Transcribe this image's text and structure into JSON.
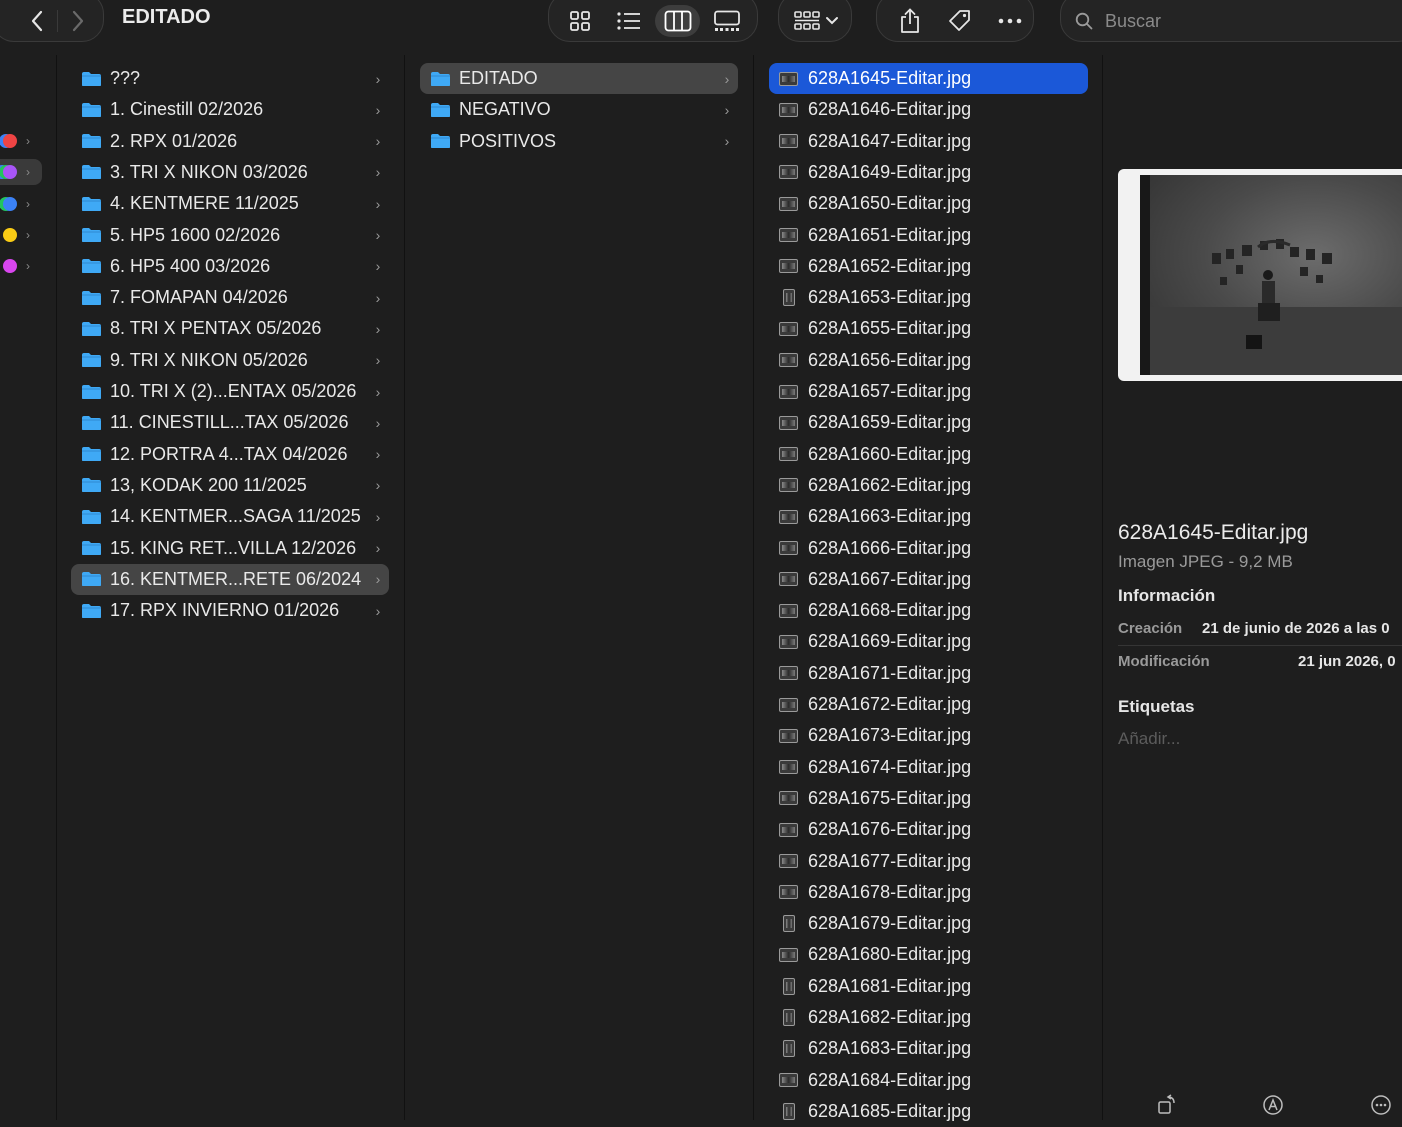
{
  "window": {
    "title": "EDITADO",
    "search_placeholder": "Buscar"
  },
  "sidebar": {
    "tags": [
      {
        "colors": [
          "#3b82f6",
          "#ef4444"
        ],
        "selected": false
      },
      {
        "colors": [
          "#3b82f6",
          "#22c55e",
          "#a855f7"
        ],
        "selected": true
      },
      {
        "colors": [
          "#22c55e",
          "#3b82f6"
        ],
        "selected": false
      },
      {
        "colors": [
          "#facc15"
        ],
        "selected": false
      },
      {
        "colors": [
          "#d946ef"
        ],
        "selected": false
      }
    ]
  },
  "column1": {
    "items": [
      {
        "label": "???",
        "selected": false
      },
      {
        "label": "1. Cinestill 02/2026",
        "selected": false
      },
      {
        "label": "2. RPX 01/2026",
        "selected": false
      },
      {
        "label": "3. TRI X NIKON  03/2026",
        "selected": false
      },
      {
        "label": "4. KENTMERE 11/2025",
        "selected": false
      },
      {
        "label": "5. HP5 1600 02/2026",
        "selected": false
      },
      {
        "label": "6. HP5 400 03/2026",
        "selected": false
      },
      {
        "label": "7. FOMAPAN 04/2026",
        "selected": false
      },
      {
        "label": "8. TRI X PENTAX 05/2026",
        "selected": false
      },
      {
        "label": "9. TRI X NIKON 05/2026",
        "selected": false
      },
      {
        "label": "10. TRI X (2)...ENTAX 05/2026",
        "selected": false
      },
      {
        "label": "11. CINESTILL...TAX 05/2026",
        "selected": false
      },
      {
        "label": "12. PORTRA 4...TAX 04/2026",
        "selected": false
      },
      {
        "label": "13, KODAK 200 11/2025",
        "selected": false
      },
      {
        "label": "14. KENTMER...SAGA 11/2025",
        "selected": false
      },
      {
        "label": "15. KING RET...VILLA 12/2026",
        "selected": false
      },
      {
        "label": "16. KENTMER...RETE 06/2024",
        "selected": true
      },
      {
        "label": "17. RPX INVIERNO 01/2026",
        "selected": false
      }
    ]
  },
  "column2": {
    "items": [
      {
        "label": "EDITADO",
        "selected": true
      },
      {
        "label": "NEGATIVO",
        "selected": false
      },
      {
        "label": "POSITIVOS",
        "selected": false
      }
    ]
  },
  "column3": {
    "files": [
      {
        "name": "628A1645-Editar.jpg",
        "selected": true,
        "orientation": "landscape"
      },
      {
        "name": "628A1646-Editar.jpg",
        "selected": false,
        "orientation": "landscape"
      },
      {
        "name": "628A1647-Editar.jpg",
        "selected": false,
        "orientation": "landscape"
      },
      {
        "name": "628A1649-Editar.jpg",
        "selected": false,
        "orientation": "landscape"
      },
      {
        "name": "628A1650-Editar.jpg",
        "selected": false,
        "orientation": "landscape"
      },
      {
        "name": "628A1651-Editar.jpg",
        "selected": false,
        "orientation": "landscape"
      },
      {
        "name": "628A1652-Editar.jpg",
        "selected": false,
        "orientation": "landscape"
      },
      {
        "name": "628A1653-Editar.jpg",
        "selected": false,
        "orientation": "portrait"
      },
      {
        "name": "628A1655-Editar.jpg",
        "selected": false,
        "orientation": "landscape"
      },
      {
        "name": "628A1656-Editar.jpg",
        "selected": false,
        "orientation": "landscape"
      },
      {
        "name": "628A1657-Editar.jpg",
        "selected": false,
        "orientation": "landscape"
      },
      {
        "name": "628A1659-Editar.jpg",
        "selected": false,
        "orientation": "landscape"
      },
      {
        "name": "628A1660-Editar.jpg",
        "selected": false,
        "orientation": "landscape"
      },
      {
        "name": "628A1662-Editar.jpg",
        "selected": false,
        "orientation": "landscape"
      },
      {
        "name": "628A1663-Editar.jpg",
        "selected": false,
        "orientation": "landscape"
      },
      {
        "name": "628A1666-Editar.jpg",
        "selected": false,
        "orientation": "landscape"
      },
      {
        "name": "628A1667-Editar.jpg",
        "selected": false,
        "orientation": "landscape"
      },
      {
        "name": "628A1668-Editar.jpg",
        "selected": false,
        "orientation": "landscape"
      },
      {
        "name": "628A1669-Editar.jpg",
        "selected": false,
        "orientation": "landscape"
      },
      {
        "name": "628A1671-Editar.jpg",
        "selected": false,
        "orientation": "landscape"
      },
      {
        "name": "628A1672-Editar.jpg",
        "selected": false,
        "orientation": "landscape"
      },
      {
        "name": "628A1673-Editar.jpg",
        "selected": false,
        "orientation": "landscape"
      },
      {
        "name": "628A1674-Editar.jpg",
        "selected": false,
        "orientation": "landscape"
      },
      {
        "name": "628A1675-Editar.jpg",
        "selected": false,
        "orientation": "landscape"
      },
      {
        "name": "628A1676-Editar.jpg",
        "selected": false,
        "orientation": "landscape"
      },
      {
        "name": "628A1677-Editar.jpg",
        "selected": false,
        "orientation": "landscape"
      },
      {
        "name": "628A1678-Editar.jpg",
        "selected": false,
        "orientation": "landscape"
      },
      {
        "name": "628A1679-Editar.jpg",
        "selected": false,
        "orientation": "portrait"
      },
      {
        "name": "628A1680-Editar.jpg",
        "selected": false,
        "orientation": "landscape"
      },
      {
        "name": "628A1681-Editar.jpg",
        "selected": false,
        "orientation": "portrait"
      },
      {
        "name": "628A1682-Editar.jpg",
        "selected": false,
        "orientation": "portrait"
      },
      {
        "name": "628A1683-Editar.jpg",
        "selected": false,
        "orientation": "portrait"
      },
      {
        "name": "628A1684-Editar.jpg",
        "selected": false,
        "orientation": "landscape"
      },
      {
        "name": "628A1685-Editar.jpg",
        "selected": false,
        "orientation": "portrait"
      }
    ]
  },
  "preview": {
    "file_name": "628A1645-Editar.jpg",
    "kind": "Imagen JPEG - 9,2 MB",
    "info_heading": "Información",
    "created_label": "Creación",
    "created_value": "21 de junio de 2026 a las 0",
    "modified_label": "Modificación",
    "modified_value": "21 jun 2026, 0",
    "tags_heading": "Etiquetas",
    "tags_placeholder": "Añadir..."
  },
  "colors": {
    "selection_blue": "#1b58d8",
    "folder_blue": "#3fa9f5"
  }
}
